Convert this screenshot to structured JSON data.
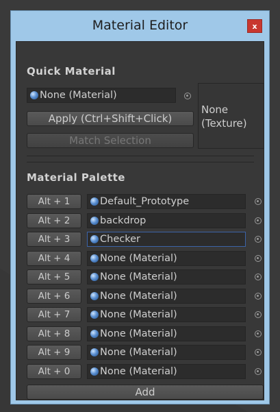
{
  "window": {
    "title": "Material Editor",
    "close_label": "x"
  },
  "quick": {
    "heading": "Quick Material",
    "material_field": "None (Material)",
    "apply_label": "Apply (Ctrl+Shift+Click)",
    "match_label": "Match Selection",
    "texture_line1": "None",
    "texture_line2": "(Texture)"
  },
  "palette": {
    "heading": "Material Palette",
    "rows": [
      {
        "key": "Alt + 1",
        "material": "Default_Prototype"
      },
      {
        "key": "Alt + 2",
        "material": "backdrop"
      },
      {
        "key": "Alt + 3",
        "material": "Checker"
      },
      {
        "key": "Alt + 4",
        "material": "None (Material)"
      },
      {
        "key": "Alt + 5",
        "material": "None (Material)"
      },
      {
        "key": "Alt + 6",
        "material": "None (Material)"
      },
      {
        "key": "Alt + 7",
        "material": "None (Material)"
      },
      {
        "key": "Alt + 8",
        "material": "None (Material)"
      },
      {
        "key": "Alt + 9",
        "material": "None (Material)"
      },
      {
        "key": "Alt + 0",
        "material": "None (Material)"
      }
    ],
    "add_label": "Add"
  },
  "colors": {
    "window_chrome": "#9fc8e8",
    "panel": "#383838",
    "close": "#c8372f",
    "selection": "#3b63a8"
  }
}
